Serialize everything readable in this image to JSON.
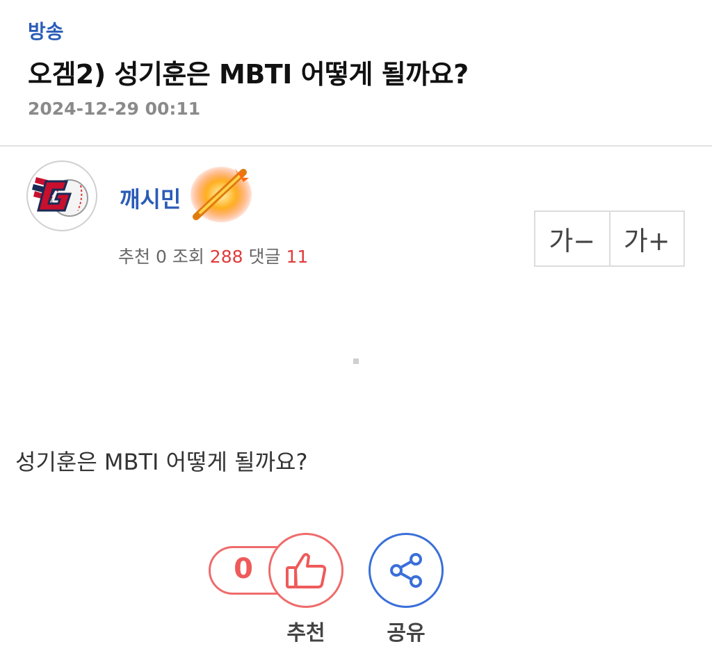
{
  "post": {
    "category": "방송",
    "title": "오겜2) 성기훈은 MBTI 어떻게 될까요?",
    "date": "2024-12-29 00:11",
    "body": "성기훈은 MBTI 어떻게 될까요?"
  },
  "author": {
    "nickname": "깨시민",
    "avatar_icon": "team-logo-icon",
    "badge_icon": "flaming-bat-icon"
  },
  "stats": {
    "recommend_label": "추천",
    "recommend_value": "0",
    "views_label": "조회",
    "views_value": "288",
    "comments_label": "댓글",
    "comments_value": "11"
  },
  "font_controls": {
    "decrease_label": "가−",
    "increase_label": "가+"
  },
  "actions": {
    "recommend_count": "0",
    "recommend_label": "추천",
    "share_label": "공유"
  },
  "colors": {
    "accent_blue": "#2a5cb8",
    "highlight_red": "#e03b3b",
    "recommend_red": "#ef6b6b",
    "share_blue": "#3a6fd8"
  }
}
